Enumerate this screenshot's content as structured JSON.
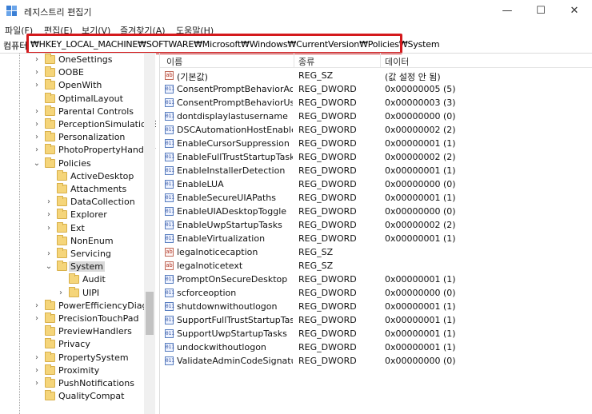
{
  "window": {
    "title": "레지스트리 편집기",
    "icon": "registry-editor-icon",
    "buttons": {
      "minimize": "—",
      "maximize": "☐",
      "close": "✕"
    }
  },
  "menu": [
    "파일(F)",
    "편집(E)",
    "보기(V)",
    "즐겨찾기(A)",
    "도움말(H)"
  ],
  "address": {
    "label": "컴퓨터",
    "path": "₩HKEY_LOCAL_MACHINE₩SOFTWARE₩Microsoft₩Windows₩CurrentVersion₩Policies₩System",
    "highlight_color": "#d4191c"
  },
  "tree": [
    {
      "label": "OneSettings",
      "expander": "›"
    },
    {
      "label": "OOBE",
      "expander": "›"
    },
    {
      "label": "OpenWith",
      "expander": "›"
    },
    {
      "label": "OptimalLayout",
      "expander": ""
    },
    {
      "label": "Parental Controls",
      "expander": "›"
    },
    {
      "label": "PerceptionSimulationE",
      "expander": "›"
    },
    {
      "label": "Personalization",
      "expander": "›"
    },
    {
      "label": "PhotoPropertyHandler",
      "expander": "›"
    },
    {
      "label": "Policies",
      "expander": "⌄"
    },
    {
      "label": "ActiveDesktop",
      "expander": ""
    },
    {
      "label": "Attachments",
      "expander": ""
    },
    {
      "label": "DataCollection",
      "expander": "›"
    },
    {
      "label": "Explorer",
      "expander": "›"
    },
    {
      "label": "Ext",
      "expander": "›"
    },
    {
      "label": "NonEnum",
      "expander": ""
    },
    {
      "label": "Servicing",
      "expander": "›"
    },
    {
      "label": "System",
      "expander": "⌄",
      "selected": true
    },
    {
      "label": "Audit",
      "expander": ""
    },
    {
      "label": "UIPI",
      "expander": "›"
    },
    {
      "label": "PowerEfficiencyDiagn",
      "expander": "›"
    },
    {
      "label": "PrecisionTouchPad",
      "expander": "›"
    },
    {
      "label": "PreviewHandlers",
      "expander": ""
    },
    {
      "label": "Privacy",
      "expander": ""
    },
    {
      "label": "PropertySystem",
      "expander": "›"
    },
    {
      "label": "Proximity",
      "expander": "›"
    },
    {
      "label": "PushNotifications",
      "expander": "›"
    },
    {
      "label": "QualityCompat",
      "expander": ""
    }
  ],
  "columns": {
    "name": "이름",
    "type": "종류",
    "data": "데이터"
  },
  "values": [
    {
      "icon": "ab",
      "name": "(기본값)",
      "type": "REG_SZ",
      "data": "(값 설정 안 됨)"
    },
    {
      "icon": "011",
      "name": "ConsentPromptBehaviorAd...",
      "type": "REG_DWORD",
      "data": "0x00000005 (5)"
    },
    {
      "icon": "011",
      "name": "ConsentPromptBehaviorUser",
      "type": "REG_DWORD",
      "data": "0x00000003 (3)"
    },
    {
      "icon": "011",
      "name": "dontdisplaylastusername",
      "type": "REG_DWORD",
      "data": "0x00000000 (0)"
    },
    {
      "icon": "011",
      "name": "DSCAutomationHostEnabled",
      "type": "REG_DWORD",
      "data": "0x00000002 (2)"
    },
    {
      "icon": "011",
      "name": "EnableCursorSuppression",
      "type": "REG_DWORD",
      "data": "0x00000001 (1)"
    },
    {
      "icon": "011",
      "name": "EnableFullTrustStartupTasks",
      "type": "REG_DWORD",
      "data": "0x00000002 (2)"
    },
    {
      "icon": "011",
      "name": "EnableInstallerDetection",
      "type": "REG_DWORD",
      "data": "0x00000001 (1)"
    },
    {
      "icon": "011",
      "name": "EnableLUA",
      "type": "REG_DWORD",
      "data": "0x00000000 (0)"
    },
    {
      "icon": "011",
      "name": "EnableSecureUIAPaths",
      "type": "REG_DWORD",
      "data": "0x00000001 (1)"
    },
    {
      "icon": "011",
      "name": "EnableUIADesktopToggle",
      "type": "REG_DWORD",
      "data": "0x00000000 (0)"
    },
    {
      "icon": "011",
      "name": "EnableUwpStartupTasks",
      "type": "REG_DWORD",
      "data": "0x00000002 (2)"
    },
    {
      "icon": "011",
      "name": "EnableVirtualization",
      "type": "REG_DWORD",
      "data": "0x00000001 (1)"
    },
    {
      "icon": "ab",
      "name": "legalnoticecaption",
      "type": "REG_SZ",
      "data": ""
    },
    {
      "icon": "ab",
      "name": "legalnoticetext",
      "type": "REG_SZ",
      "data": ""
    },
    {
      "icon": "011",
      "name": "PromptOnSecureDesktop",
      "type": "REG_DWORD",
      "data": "0x00000001 (1)"
    },
    {
      "icon": "011",
      "name": "scforceoption",
      "type": "REG_DWORD",
      "data": "0x00000000 (0)"
    },
    {
      "icon": "011",
      "name": "shutdownwithoutlogon",
      "type": "REG_DWORD",
      "data": "0x00000001 (1)"
    },
    {
      "icon": "011",
      "name": "SupportFullTrustStartupTasks",
      "type": "REG_DWORD",
      "data": "0x00000001 (1)"
    },
    {
      "icon": "011",
      "name": "SupportUwpStartupTasks",
      "type": "REG_DWORD",
      "data": "0x00000001 (1)"
    },
    {
      "icon": "011",
      "name": "undockwithoutlogon",
      "type": "REG_DWORD",
      "data": "0x00000001 (1)"
    },
    {
      "icon": "011",
      "name": "ValidateAdminCodeSignatu...",
      "type": "REG_DWORD",
      "data": "0x00000000 (0)"
    }
  ]
}
